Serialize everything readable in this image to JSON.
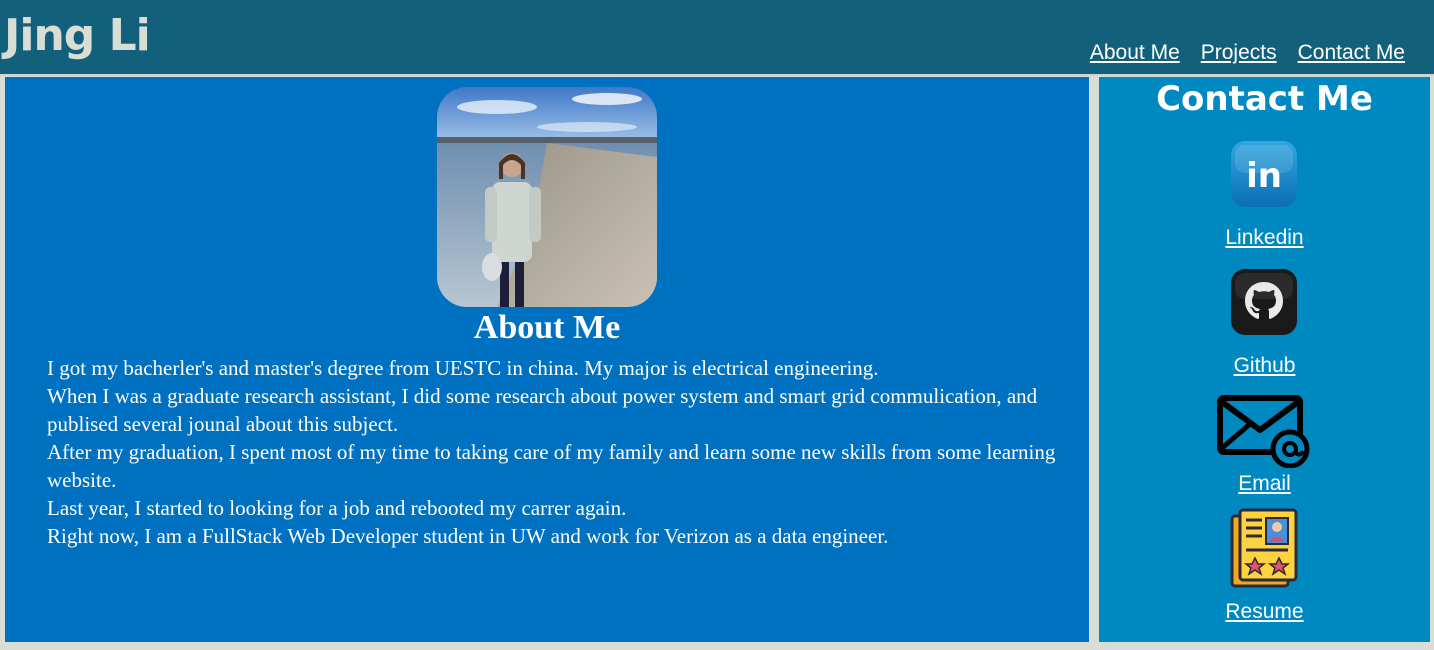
{
  "header": {
    "title": "Jing Li",
    "nav": [
      "About Me",
      "Projects",
      "Contact Me"
    ]
  },
  "about": {
    "heading": "About Me",
    "paragraphs": [
      "I got my bacherler's and master's degree from UESTC in china. My major is electrical engineering.",
      "When I was a graduate research assistant, I did some research about power system and smart grid commulication, and publised several jounal about this subject.",
      "After my graduation, I spent most of my time to taking care of my family and learn some new skills from some learning website.",
      "Last year, I started to looking for a job and rebooted my carrer again.",
      "Right now, I am a FullStack Web Developer student in UW and work for Verizon as a data engineer."
    ]
  },
  "contact": {
    "heading": "Contact Me",
    "items": [
      {
        "label": "Linkedin",
        "icon": "linkedin-icon",
        "icon_text": "in"
      },
      {
        "label": "Github",
        "icon": "github-icon"
      },
      {
        "label": "Email",
        "icon": "email-icon"
      },
      {
        "label": "Resume",
        "icon": "resume-icon"
      }
    ]
  },
  "colors": {
    "header_bg": "#13607c",
    "about_bg": "#0070c0",
    "contact_bg": "#0089c1",
    "page_bg": "#d8ddd6"
  }
}
